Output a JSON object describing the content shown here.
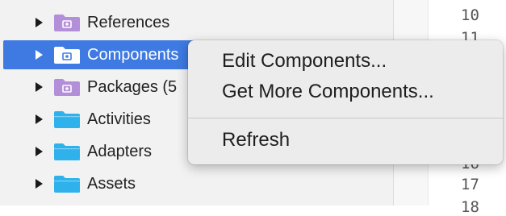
{
  "tree": {
    "items": [
      {
        "label": "References",
        "folder": "purple"
      },
      {
        "label": "Components",
        "folder": "purple",
        "selected": true
      },
      {
        "label": "Packages (5",
        "folder": "purple"
      },
      {
        "label": "Activities",
        "folder": "blue"
      },
      {
        "label": "Adapters",
        "folder": "blue"
      },
      {
        "label": "Assets",
        "folder": "blue"
      }
    ]
  },
  "editor": {
    "line_numbers": [
      "10",
      "11",
      "16",
      "17",
      "18"
    ]
  },
  "context_menu": {
    "items": [
      {
        "label": "Edit Components..."
      },
      {
        "label": "Get More Components..."
      },
      {
        "label": "Refresh"
      }
    ]
  },
  "colors": {
    "selection": "#3e7ae2",
    "folder_purple": "#b48fd9",
    "folder_blue": "#2fb2ec"
  }
}
